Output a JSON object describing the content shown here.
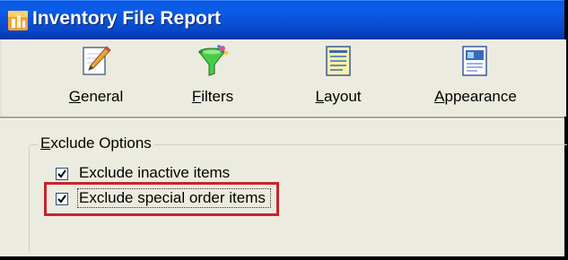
{
  "window": {
    "title": "Inventory File Report",
    "app_icon": "report-app-icon",
    "title_bar_color": "#0a55dd"
  },
  "toolbar": {
    "items": [
      {
        "label": "General",
        "mnemonic": "G",
        "rest": "eneral",
        "icon": "pencil-paper-icon"
      },
      {
        "label": "Filters",
        "mnemonic": "F",
        "rest": "ilters",
        "icon": "funnel-icon"
      },
      {
        "label": "Layout",
        "mnemonic": "L",
        "rest": "ayout",
        "icon": "layout-document-icon"
      },
      {
        "label": "Appearance",
        "mnemonic": "A",
        "rest": "ppearance",
        "icon": "appearance-document-icon"
      }
    ]
  },
  "exclude_options": {
    "legend": "Exclude Options",
    "legend_mnemonic": "E",
    "legend_rest": "xclude Options",
    "checkboxes": [
      {
        "label": "Exclude inactive items",
        "checked": true
      },
      {
        "label": "Exclude special order items",
        "checked": true,
        "highlighted": true
      }
    ],
    "highlight_color": "#c8242c"
  }
}
